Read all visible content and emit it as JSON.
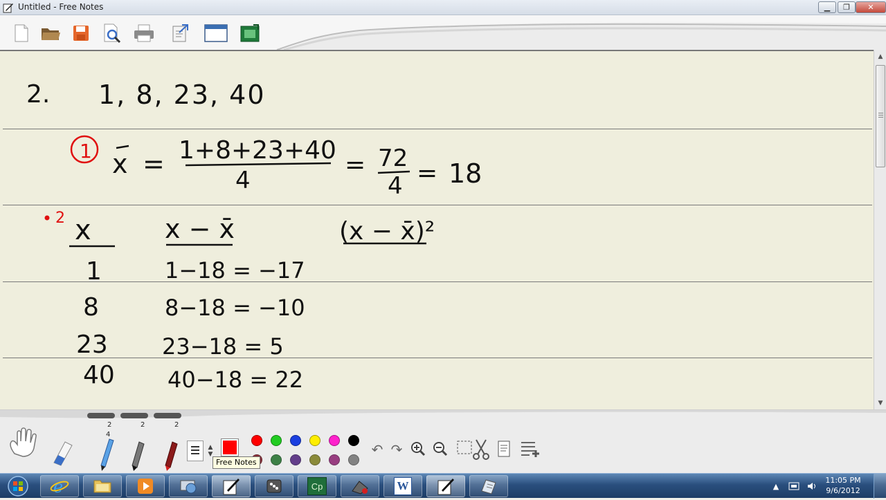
{
  "window": {
    "title": "Untitled - Free Notes",
    "minimize_label": "▁",
    "maximize_label": "❐",
    "close_label": "✕"
  },
  "toolbar": {
    "buttons": [
      "new-document-icon",
      "open-folder-icon",
      "save-icon",
      "print-preview-icon",
      "print-icon",
      "export-icon",
      "window-icon",
      "capture-icon"
    ]
  },
  "notes": {
    "problem_number": "2.",
    "data_list": "1, 8, 23, 40",
    "step1_marker": "1",
    "mean_formula": "x̄ = (1+8+23+40)/4 = 72/4 = 18",
    "step2_marker": "2",
    "headers": [
      "x",
      "x − x̄",
      "(x − x̄)²"
    ],
    "rows": [
      {
        "x": "1",
        "diff": "1−18 = −17"
      },
      {
        "x": "8",
        "diff": "8−18 = −10"
      },
      {
        "x": "23",
        "diff": "23−18 = 5"
      },
      {
        "x": "40",
        "diff": "40−18 = 22"
      }
    ]
  },
  "pentray": {
    "pen_counts": [
      "2",
      "2",
      "2"
    ],
    "pen_size_marker": "4",
    "tooltip": "Free Notes",
    "colors_row1": [
      "#ff0000",
      "#22cc22",
      "#1b3fe0",
      "#ffee00",
      "#ff22cc",
      "#000000"
    ],
    "colors_row2": [
      "#7a0f1a",
      "#1f6e2a",
      "#4a1f7a",
      "#7a7a1a",
      "#8a1f6e",
      "#707070"
    ],
    "current_color": "#ff0000"
  },
  "taskbar": {
    "time": "11:05 PM",
    "date": "9/6/2012",
    "apps": [
      "internet-explorer-icon",
      "explorer-folder-icon",
      "media-player-icon",
      "network-tool-icon",
      "free-notes-icon",
      "dice-app-icon",
      "captivate-icon",
      "recorder-icon",
      "word-icon",
      "pen-app-icon",
      "notes-app-icon"
    ],
    "captivate_label": "Cp",
    "word_label": "W"
  }
}
